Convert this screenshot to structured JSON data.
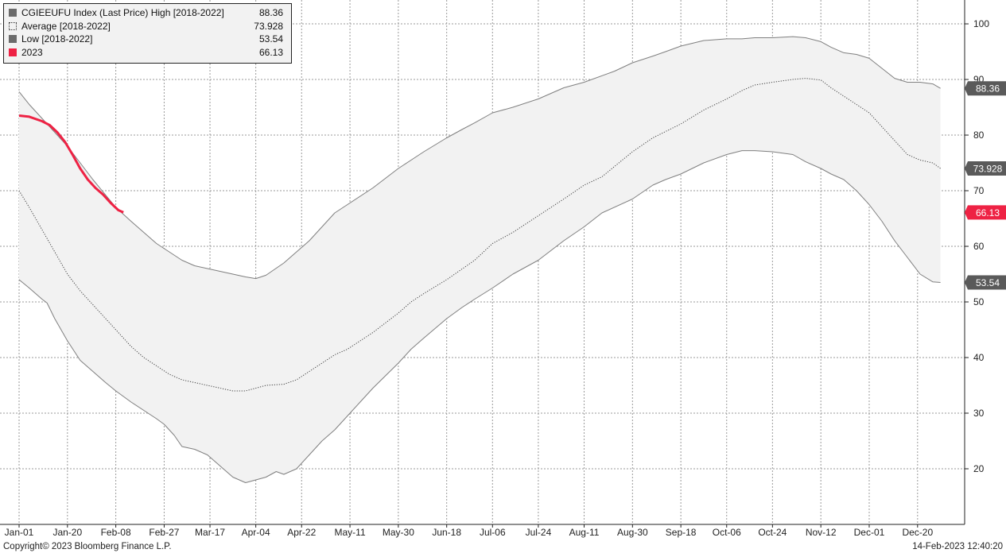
{
  "legend": {
    "items": [
      {
        "label": "CGIEEUFU Index (Last Price) High [2018-2022]",
        "value": "88.36",
        "swatch": "solid-gray"
      },
      {
        "label": "Average  [2018-2022]",
        "value": "73.928",
        "swatch": "dotted"
      },
      {
        "label": "Low  [2018-2022]",
        "value": "53.54",
        "swatch": "solid-gray"
      },
      {
        "label": "2023",
        "value": "66.13",
        "swatch": "solid-red"
      }
    ]
  },
  "footer": {
    "copyright": "Copyright© 2023 Bloomberg Finance L.P.",
    "timestamp": "14-Feb-2023 12:40:20"
  },
  "colors": {
    "band_fill": "#f2f2f2",
    "band_line": "#7f7f7f",
    "average_line": "#404040",
    "current_year": "#ee2244",
    "grid": "#9a9a9a",
    "label_gray_bg": "#5a5a5a",
    "label_red_bg": "#ee2244"
  },
  "chart_data": {
    "type": "line",
    "x_unit": "day_of_year",
    "xlim": [
      1,
      365
    ],
    "ylim": [
      10,
      100
    ],
    "y_ticks": [
      20,
      30,
      40,
      50,
      60,
      70,
      80,
      90,
      100
    ],
    "x_tick_labels": [
      {
        "label": "Jan-01",
        "day": 1
      },
      {
        "label": "Jan-20",
        "day": 20
      },
      {
        "label": "Feb-08",
        "day": 39
      },
      {
        "label": "Feb-27",
        "day": 58
      },
      {
        "label": "Mar-17",
        "day": 76
      },
      {
        "label": "Apr-04",
        "day": 94
      },
      {
        "label": "Apr-22",
        "day": 112
      },
      {
        "label": "May-11",
        "day": 131
      },
      {
        "label": "May-30",
        "day": 150
      },
      {
        "label": "Jun-18",
        "day": 169
      },
      {
        "label": "Jul-06",
        "day": 187
      },
      {
        "label": "Jul-24",
        "day": 205
      },
      {
        "label": "Aug-11",
        "day": 223
      },
      {
        "label": "Aug-30",
        "day": 242
      },
      {
        "label": "Sep-18",
        "day": 261
      },
      {
        "label": "Oct-06",
        "day": 279
      },
      {
        "label": "Oct-24",
        "day": 297
      },
      {
        "label": "Nov-12",
        "day": 316
      },
      {
        "label": "Dec-01",
        "day": 335
      },
      {
        "label": "Dec-20",
        "day": 354
      }
    ],
    "grid": true,
    "legend_position": "top-left",
    "series": [
      {
        "name": "CGIEEUFU Index (Last Price) High [2018-2022]",
        "style": "solid-gray",
        "last_label": "88.36",
        "x": [
          1,
          5,
          10,
          15,
          20,
          25,
          30,
          39,
          45,
          50,
          55,
          60,
          65,
          70,
          75,
          80,
          85,
          90,
          94,
          98,
          105,
          110,
          115,
          120,
          125,
          130,
          140,
          150,
          155,
          160,
          169,
          175,
          180,
          187,
          195,
          205,
          215,
          223,
          235,
          242,
          250,
          255,
          261,
          270,
          279,
          285,
          290,
          297,
          305,
          310,
          316,
          320,
          325,
          330,
          335,
          340,
          345,
          350,
          355,
          360,
          363
        ],
        "values": [
          87.8,
          85.5,
          83.0,
          80.5,
          78.0,
          75.0,
          72.0,
          67.0,
          64.5,
          62.5,
          60.5,
          59.0,
          57.5,
          56.5,
          56.0,
          55.5,
          55.0,
          54.5,
          54.2,
          54.8,
          57.0,
          59.0,
          61.0,
          63.5,
          66.0,
          67.5,
          70.5,
          74.0,
          75.5,
          77.0,
          79.5,
          81.0,
          82.2,
          84.0,
          85.0,
          86.5,
          88.5,
          89.5,
          91.5,
          93.0,
          94.2,
          95.0,
          96.0,
          97.0,
          97.3,
          97.3,
          97.5,
          97.5,
          97.7,
          97.5,
          96.8,
          95.8,
          94.8,
          94.5,
          93.8,
          92.0,
          90.2,
          89.5,
          89.5,
          89.2,
          88.4
        ]
      },
      {
        "name": "Average  [2018-2022]",
        "style": "dotted",
        "last_label": "73.928",
        "x": [
          1,
          5,
          10,
          15,
          20,
          25,
          30,
          35,
          39,
          45,
          50,
          55,
          60,
          65,
          70,
          75,
          80,
          85,
          90,
          94,
          98,
          105,
          110,
          115,
          120,
          125,
          130,
          135,
          140,
          150,
          155,
          160,
          169,
          180,
          187,
          195,
          205,
          215,
          223,
          230,
          242,
          250,
          261,
          270,
          279,
          285,
          290,
          297,
          305,
          310,
          316,
          320,
          325,
          330,
          335,
          340,
          345,
          350,
          355,
          360,
          363
        ],
        "values": [
          70.0,
          67.0,
          63.0,
          59.0,
          55.0,
          52.0,
          49.5,
          47.0,
          45.0,
          42.0,
          40.0,
          38.5,
          37.0,
          36.0,
          35.5,
          35.0,
          34.5,
          34.0,
          34.0,
          34.5,
          35.0,
          35.2,
          36.0,
          37.5,
          39.0,
          40.5,
          41.5,
          43.0,
          44.5,
          48.0,
          50.0,
          51.5,
          54.0,
          57.5,
          60.5,
          62.5,
          65.5,
          68.5,
          71.0,
          72.5,
          77.0,
          79.5,
          82.0,
          84.5,
          86.5,
          88.0,
          89.0,
          89.5,
          90.0,
          90.2,
          89.9,
          88.5,
          87.0,
          85.5,
          84.0,
          81.5,
          79.0,
          76.5,
          75.5,
          75.0,
          74.0
        ]
      },
      {
        "name": "Low  [2018-2022]",
        "style": "solid-gray",
        "last_label": "53.54",
        "x": [
          1,
          5,
          10,
          12,
          15,
          20,
          25,
          30,
          35,
          39,
          45,
          50,
          55,
          58,
          62,
          65,
          70,
          75,
          80,
          85,
          90,
          94,
          98,
          102,
          105,
          110,
          115,
          120,
          125,
          130,
          135,
          140,
          150,
          155,
          160,
          169,
          175,
          180,
          187,
          195,
          205,
          215,
          223,
          230,
          242,
          250,
          255,
          261,
          270,
          279,
          285,
          290,
          297,
          305,
          310,
          316,
          320,
          325,
          330,
          335,
          340,
          345,
          350,
          355,
          360,
          363
        ],
        "values": [
          54.0,
          52.5,
          50.5,
          49.8,
          47.0,
          43.0,
          39.5,
          37.5,
          35.5,
          34.0,
          32.0,
          30.5,
          29.0,
          28.0,
          26.0,
          24.0,
          23.5,
          22.5,
          20.5,
          18.5,
          17.5,
          18.0,
          18.5,
          19.5,
          19.0,
          20.0,
          22.5,
          25.0,
          27.0,
          29.5,
          32.0,
          34.5,
          39.0,
          41.5,
          43.5,
          47.0,
          49.0,
          50.5,
          52.5,
          55.0,
          57.5,
          61.0,
          63.5,
          66.0,
          68.5,
          71.0,
          72.0,
          73.0,
          75.0,
          76.5,
          77.2,
          77.2,
          77.0,
          76.5,
          75.2,
          74.0,
          73.0,
          72.0,
          70.0,
          67.5,
          64.5,
          61.0,
          58.0,
          55.0,
          53.6,
          53.5
        ]
      },
      {
        "name": "2023",
        "style": "solid-red",
        "last_label": "66.13",
        "x": [
          1,
          5,
          10,
          13,
          16,
          19,
          22,
          25,
          28,
          31,
          34,
          37,
          40,
          42
        ],
        "values": [
          83.5,
          83.3,
          82.5,
          81.8,
          80.5,
          78.8,
          76.5,
          74.0,
          72.0,
          70.5,
          69.3,
          67.8,
          66.5,
          66.1
        ]
      }
    ]
  }
}
